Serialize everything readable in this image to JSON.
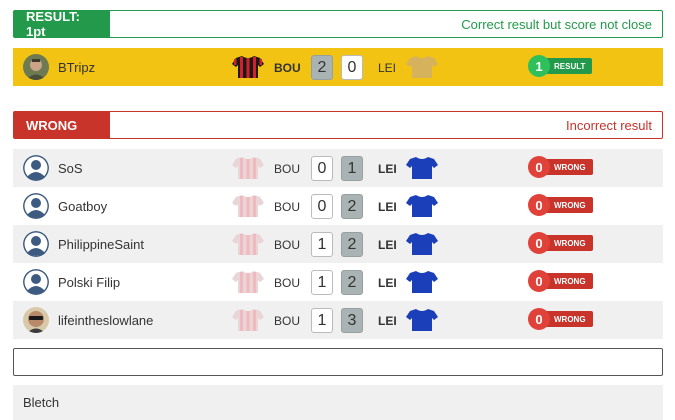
{
  "result_section": {
    "tag": "RESULT: 1pt",
    "description": "Correct result but score not close",
    "rows": [
      {
        "user": "BTripz",
        "home_team": "BOU",
        "away_team": "LEI",
        "home_score": "2",
        "away_score": "0",
        "points": "1",
        "points_label": "RESULT"
      }
    ]
  },
  "wrong_section": {
    "tag": "WRONG",
    "description": "Incorrect result",
    "rows": [
      {
        "user": "SoS",
        "home_team": "BOU",
        "away_team": "LEI",
        "home_score": "0",
        "away_score": "1",
        "points": "0",
        "points_label": "WRONG"
      },
      {
        "user": "Goatboy",
        "home_team": "BOU",
        "away_team": "LEI",
        "home_score": "0",
        "away_score": "2",
        "points": "0",
        "points_label": "WRONG"
      },
      {
        "user": "PhilippineSaint",
        "home_team": "BOU",
        "away_team": "LEI",
        "home_score": "1",
        "away_score": "2",
        "points": "0",
        "points_label": "WRONG"
      },
      {
        "user": "Polski Filip",
        "home_team": "BOU",
        "away_team": "LEI",
        "home_score": "1",
        "away_score": "2",
        "points": "0",
        "points_label": "WRONG"
      },
      {
        "user": "lifeintheslowlane",
        "home_team": "BOU",
        "away_team": "LEI",
        "home_score": "1",
        "away_score": "3",
        "points": "0",
        "points_label": "WRONG"
      }
    ]
  },
  "bottom_row": {
    "user": "Bletch"
  },
  "colors": {
    "result_green": "#239a4b",
    "wrong_red": "#c8332a",
    "highlight_yellow": "#f2c312",
    "bou_red": "#d3202a",
    "lei_blue": "#1b3fb8"
  },
  "icons": {
    "home_shirt": "bou-shirt-icon",
    "away_shirt": "lei-shirt-icon",
    "default_avatar": "user-silhouette-icon"
  }
}
